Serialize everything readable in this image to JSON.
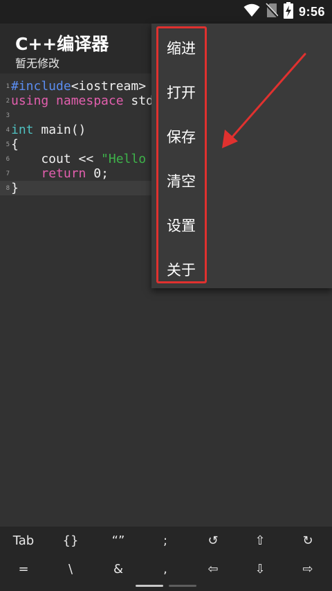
{
  "status_bar": {
    "time": "9:56",
    "icons": [
      "wifi-icon",
      "no-sim-icon",
      "battery-charging-icon"
    ]
  },
  "app_bar": {
    "title": "C++编译器",
    "subtitle": "暂无修改"
  },
  "editor": {
    "lines": [
      {
        "num": "1",
        "tokens": [
          {
            "t": "#include",
            "c": "pre"
          },
          {
            "t": "<iostream>",
            "c": "plain"
          }
        ]
      },
      {
        "num": "2",
        "tokens": [
          {
            "t": "using namespace ",
            "c": "kw"
          },
          {
            "t": "std;",
            "c": "plain"
          }
        ]
      },
      {
        "num": "3",
        "tokens": []
      },
      {
        "num": "4",
        "tokens": [
          {
            "t": "int",
            "c": "type"
          },
          {
            "t": " main()",
            "c": "plain"
          }
        ]
      },
      {
        "num": "5",
        "tokens": [
          {
            "t": "{",
            "c": "plain"
          }
        ]
      },
      {
        "num": "6",
        "tokens": [
          {
            "t": "    cout << ",
            "c": "plain"
          },
          {
            "t": "\"Hello",
            "c": "str"
          }
        ]
      },
      {
        "num": "7",
        "tokens": [
          {
            "t": "    ",
            "c": "plain"
          },
          {
            "t": "return",
            "c": "kw"
          },
          {
            "t": " 0;",
            "c": "plain"
          }
        ]
      },
      {
        "num": "8",
        "tokens": [
          {
            "t": "}",
            "c": "plain"
          }
        ]
      }
    ]
  },
  "menu": {
    "items": [
      "缩进",
      "打开",
      "保存",
      "清空",
      "设置",
      "关于"
    ]
  },
  "annotation": {
    "box_color": "#e0312f",
    "arrow_color": "#e0312f"
  },
  "key_bar": {
    "row1": [
      "Tab",
      "{}",
      "“”",
      ";",
      "↺",
      "⇧",
      "↻"
    ],
    "row2": [
      "=",
      "\\",
      "&",
      ",",
      "⇦",
      "⇩",
      "⇨"
    ]
  }
}
